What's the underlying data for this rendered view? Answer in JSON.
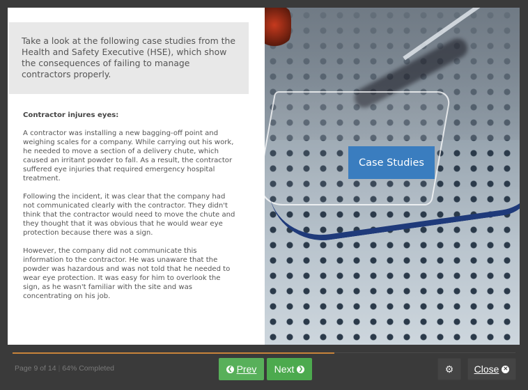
{
  "slide": {
    "intro_text": "Take a look at the following case studies from the Health and Safety Executive (HSE), which show the consequences of failing to manage contractors properly.",
    "case_title": "Contractor injures eyes:",
    "paragraphs": [
      "A contractor was installing a new bagging-off point and weighing scales for a company. While carrying out his work, he needed to move a section of a delivery chute, which caused an irritant powder to fall. As a result, the contractor suffered eye injuries that required emergency hospital treatment.",
      "Following the incident, it was clear that the company had not communicated clearly with the contractor. They didn't think that the contractor would need to move the chute and they thought that it was obvious that he would wear eye protection because there was a sign.",
      "However, the company did not communicate this information to the contractor. He was unaware that the powder was hazardous and was not told that he needed to wear eye protection. It was easy for him to overlook the sign, as he wasn't familiar with the site and was concentrating on his job."
    ],
    "image_label": "Case Studies",
    "image_subject": "safety glasses on perforated metal"
  },
  "footer": {
    "page_text": "Page 9 of 14",
    "separator": "|",
    "completed_text": "64% Completed",
    "progress_percent": 64,
    "prev_label": "Prev",
    "next_label": "Next",
    "close_label": "Close",
    "icons": {
      "prev": "chevron-left-circle-icon",
      "next": "chevron-right-circle-icon",
      "settings": "gears-icon",
      "close": "times-circle-icon"
    }
  },
  "colors": {
    "progress": "#c8843a",
    "nav_button": "#58b05a",
    "label_bg": "#3a7dbf",
    "background": "#3a3a3a"
  }
}
